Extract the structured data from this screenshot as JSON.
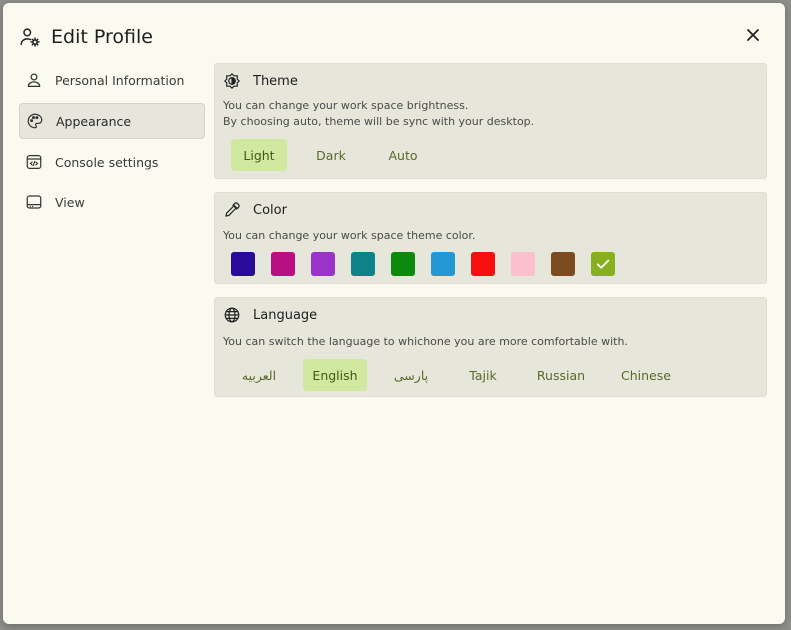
{
  "header": {
    "title": "Edit Profile",
    "icon": "user-gear-icon",
    "close_icon": "close-icon"
  },
  "sidebar": {
    "items": [
      {
        "label": "Personal Information",
        "icon": "person-icon",
        "active": false
      },
      {
        "label": "Appearance",
        "icon": "palette-icon",
        "active": true
      },
      {
        "label": "Console settings",
        "icon": "code-window-icon",
        "active": false
      },
      {
        "label": "View",
        "icon": "layout-icon",
        "active": false
      }
    ]
  },
  "theme": {
    "title": "Theme",
    "icon": "brightness-icon",
    "desc_line1": "You can change your work space brightness.",
    "desc_line2": "By choosing auto, theme will be sync with your desktop.",
    "options": [
      "Light",
      "Dark",
      "Auto"
    ],
    "selected": "Light"
  },
  "color": {
    "title": "Color",
    "icon": "eyedropper-icon",
    "desc": "You can change your work space theme color.",
    "swatches": [
      "#2a0a9a",
      "#b81082",
      "#9a34c8",
      "#0d8289",
      "#0b8a0b",
      "#2298d4",
      "#f80f0f",
      "#fbbfcd",
      "#7b4a1e",
      "#86b01c"
    ],
    "selected_index": 9
  },
  "language": {
    "title": "Language",
    "icon": "globe-icon",
    "desc": "You can switch the language to whichone you are more comfortable with.",
    "options": [
      "العربيه",
      "English",
      "پارسی",
      "Tajik",
      "Russian",
      "Chinese"
    ],
    "selected": "English"
  }
}
